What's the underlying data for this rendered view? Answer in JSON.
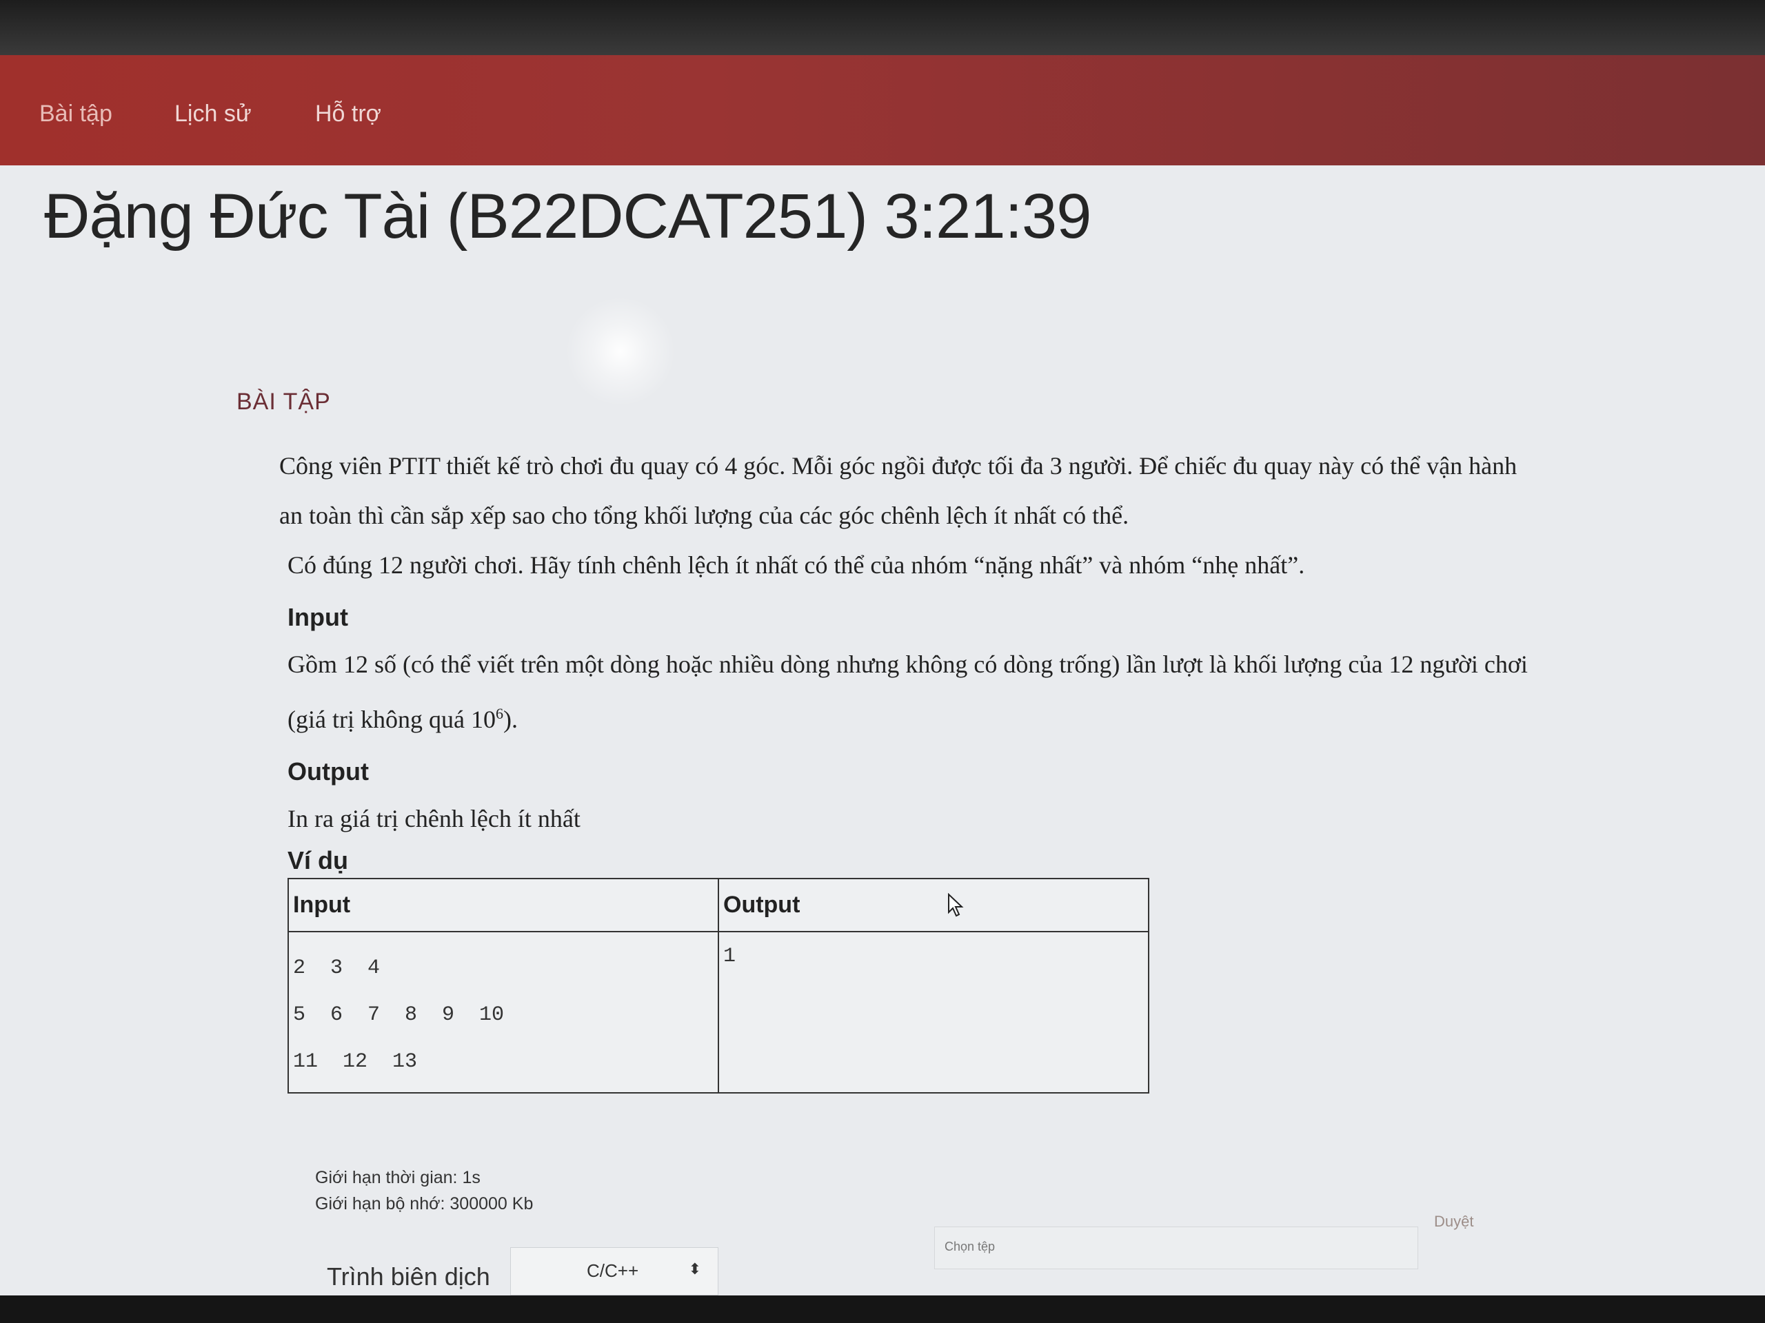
{
  "nav": {
    "items": [
      {
        "label": "Bài tập"
      },
      {
        "label": "Lịch sử"
      },
      {
        "label": "Hỗ trợ"
      }
    ]
  },
  "header": {
    "title": "Đặng Đức Tài (B22DCAT251) 3:21:39"
  },
  "section": {
    "label": "BÀI TẬP"
  },
  "problem": {
    "statement_1": "Công viên PTIT thiết kế trò chơi đu quay có 4 góc. Mỗi góc ngồi được tối đa 3 người. Để chiếc đu quay này có thể vận hành an toàn thì cần sắp xếp sao cho tổng khối lượng của các góc chênh lệch ít nhất có thể.",
    "statement_2": "Có đúng 12 người chơi. Hãy tính chênh lệch ít nhất có thể của nhóm “nặng nhất” và nhóm “nhẹ nhất”.",
    "input_heading": "Input",
    "input_desc": "Gồm 12 số (có thể viết trên một dòng hoặc nhiều dòng nhưng không có dòng trống) lần lượt là khối lượng của 12 người chơi (giá trị không quá 10",
    "input_desc_sup": "6",
    "input_desc_end": ").",
    "output_heading": "Output",
    "output_desc": "In ra giá trị chênh lệch ít nhất",
    "example_heading": "Ví dụ",
    "example": {
      "headers": [
        "Input",
        "Output"
      ],
      "input_lines": [
        "2  3  4",
        "5  6  7  8  9  10",
        "11  12  13"
      ],
      "output": "1"
    }
  },
  "limits": {
    "time": "Giới hạn thời gian: 1s",
    "memory": "Giới hạn bộ nhớ: 300000 Kb"
  },
  "submit": {
    "compiler_label": "Trình biên dịch",
    "compiler_value": "C/C++",
    "file_placeholder": "Chọn tệp",
    "browse_label": "Duyệt"
  }
}
